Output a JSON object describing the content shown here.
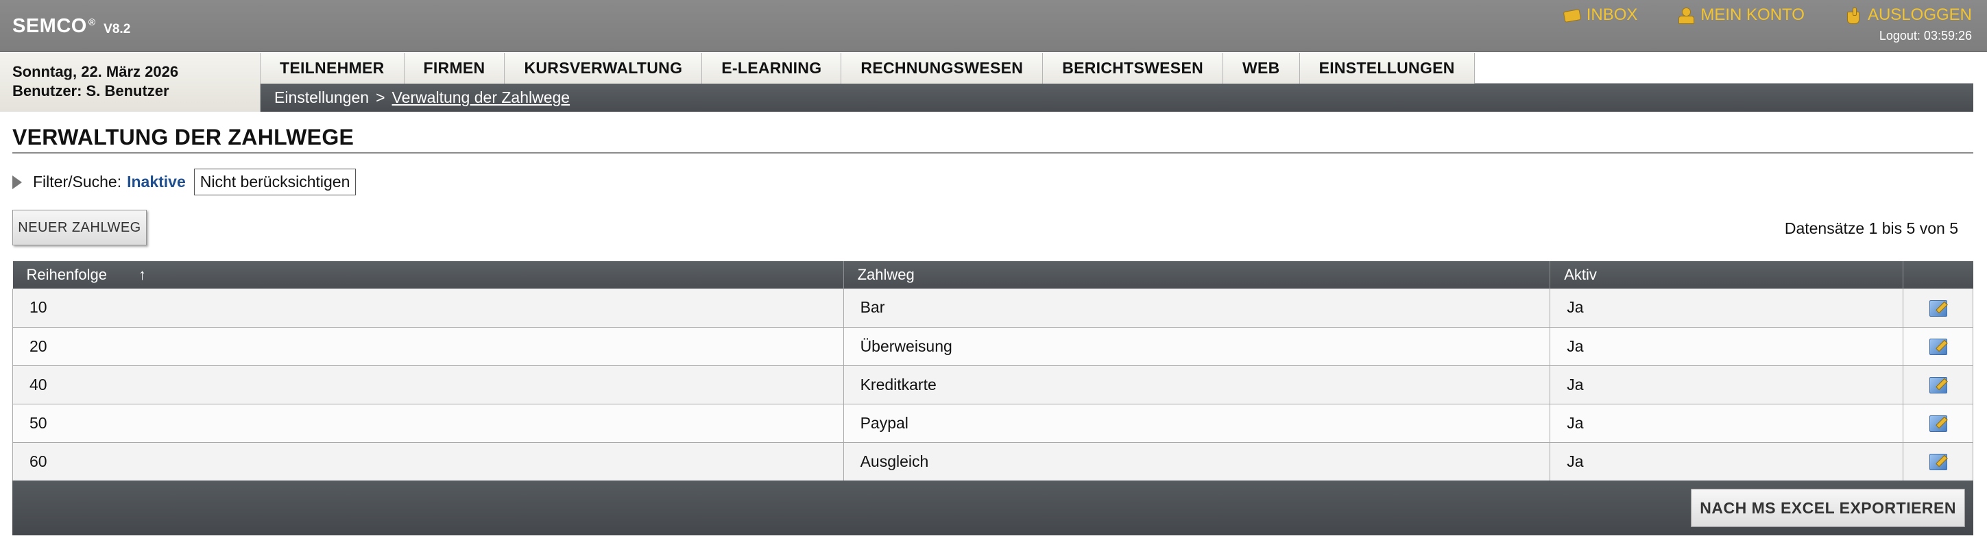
{
  "header": {
    "brand": "SEMCO",
    "brand_mark": "®",
    "version": "V8.2",
    "links": {
      "inbox": "INBOX",
      "account": "MEIN KONTO",
      "logout": "AUSLOGGEN"
    },
    "logout_timer": "Logout: 03:59:26",
    "link_color": "#f2c431"
  },
  "session": {
    "date": "Sonntag, 22. März 2026",
    "user": "Benutzer: S. Benutzer"
  },
  "nav": {
    "items": [
      "TEILNEHMER",
      "FIRMEN",
      "KURSVERWALTUNG",
      "E-LEARNING",
      "RECHNUNGSWESEN",
      "BERICHTSWESEN",
      "WEB",
      "EINSTELLUNGEN"
    ]
  },
  "breadcrumb": {
    "parent": "Einstellungen",
    "separator": ">",
    "current": "Verwaltung der Zahlwege"
  },
  "page": {
    "title": "VERWALTUNG DER ZAHLWEGE"
  },
  "filter": {
    "label": "Filter/Suche:",
    "field": "Inaktive",
    "selected": "Nicht berücksichtigen"
  },
  "actions": {
    "new_label": "NEUER ZAHLWEG",
    "export_label": "NACH MS EXCEL EXPORTIEREN"
  },
  "records_info": "Datensätze 1 bis 5 von 5",
  "table": {
    "columns": {
      "order": "Reihenfolge",
      "order_sort": "↑",
      "method": "Zahlweg",
      "active": "Aktiv"
    },
    "rows": [
      {
        "order": "10",
        "method": "Bar",
        "active": "Ja"
      },
      {
        "order": "20",
        "method": "Überweisung",
        "active": "Ja"
      },
      {
        "order": "40",
        "method": "Kreditkarte",
        "active": "Ja"
      },
      {
        "order": "50",
        "method": "Paypal",
        "active": "Ja"
      },
      {
        "order": "60",
        "method": "Ausgleich",
        "active": "Ja"
      }
    ],
    "row_action_icon": "edit-icon"
  }
}
